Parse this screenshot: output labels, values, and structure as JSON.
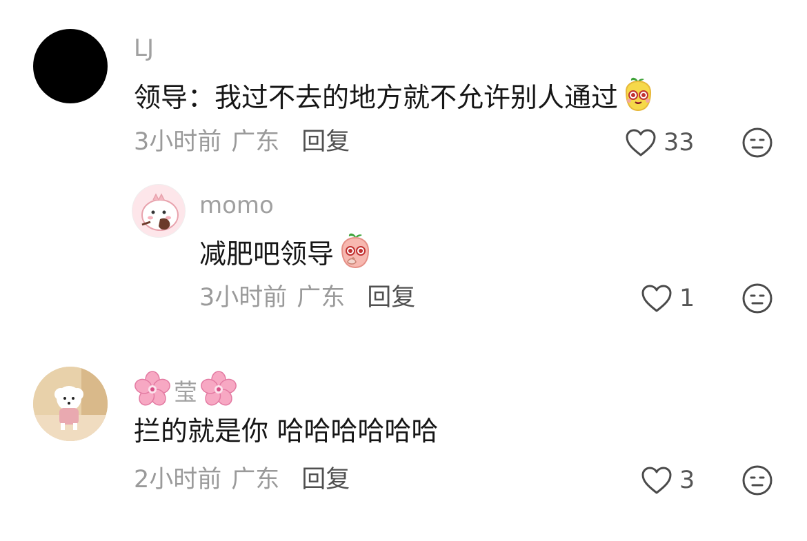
{
  "comments": [
    {
      "username": "LJ",
      "text": "领导：我过不去的地方就不允许别人通过",
      "emoji": "yellow-mascot-emoji",
      "time": "3小时前",
      "location": "广东",
      "reply_label": "回复",
      "likes": "33",
      "avatar": "black-circle-avatar"
    },
    {
      "username": "momo",
      "text": "减肥吧领导",
      "emoji": "pink-mascot-emoji",
      "time": "3小时前",
      "location": "广东",
      "reply_label": "回复",
      "likes": "1",
      "avatar": "pink-cartoon-avatar",
      "is_reply": true
    },
    {
      "username": "莹",
      "username_decoration": "cherry-blossom-emoji",
      "text": "拦的就是你 哈哈哈哈哈哈",
      "time": "2小时前",
      "location": "广东",
      "reply_label": "回复",
      "likes": "3",
      "avatar": "white-poodle-avatar"
    }
  ],
  "icons": {
    "like": "heart-outline-icon",
    "dislike": "neutral-face-icon"
  }
}
